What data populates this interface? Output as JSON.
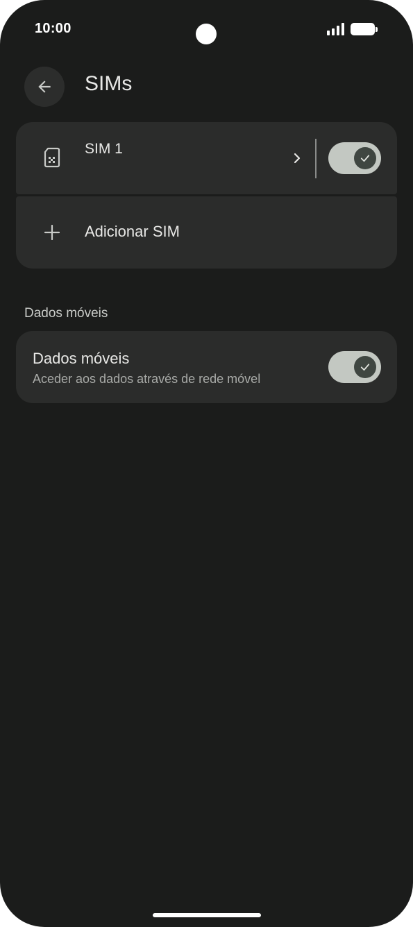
{
  "status_bar": {
    "time": "10:00",
    "icons": [
      "signal-icon",
      "battery-icon"
    ]
  },
  "app_bar": {
    "back_icon": "arrow-back-icon",
    "title": "SIMs"
  },
  "sims": {
    "items": [
      {
        "label": "SIM 1",
        "icon": "sim-card-icon",
        "toggle_on": true
      }
    ],
    "add_label": "Adicionar SIM",
    "add_icon": "plus-icon"
  },
  "mobile_data": {
    "section_header": "Dados móveis",
    "title": "Dados móveis",
    "subtitle": "Aceder aos dados através de rede móvel",
    "toggle_on": true
  },
  "colors": {
    "background": "#1b1c1b",
    "card": "#2b2c2b",
    "toggle_track": "#c3c8c2",
    "toggle_thumb": "#3f4641",
    "text_primary": "#e8e8e6",
    "text_secondary": "#a9aba8"
  }
}
